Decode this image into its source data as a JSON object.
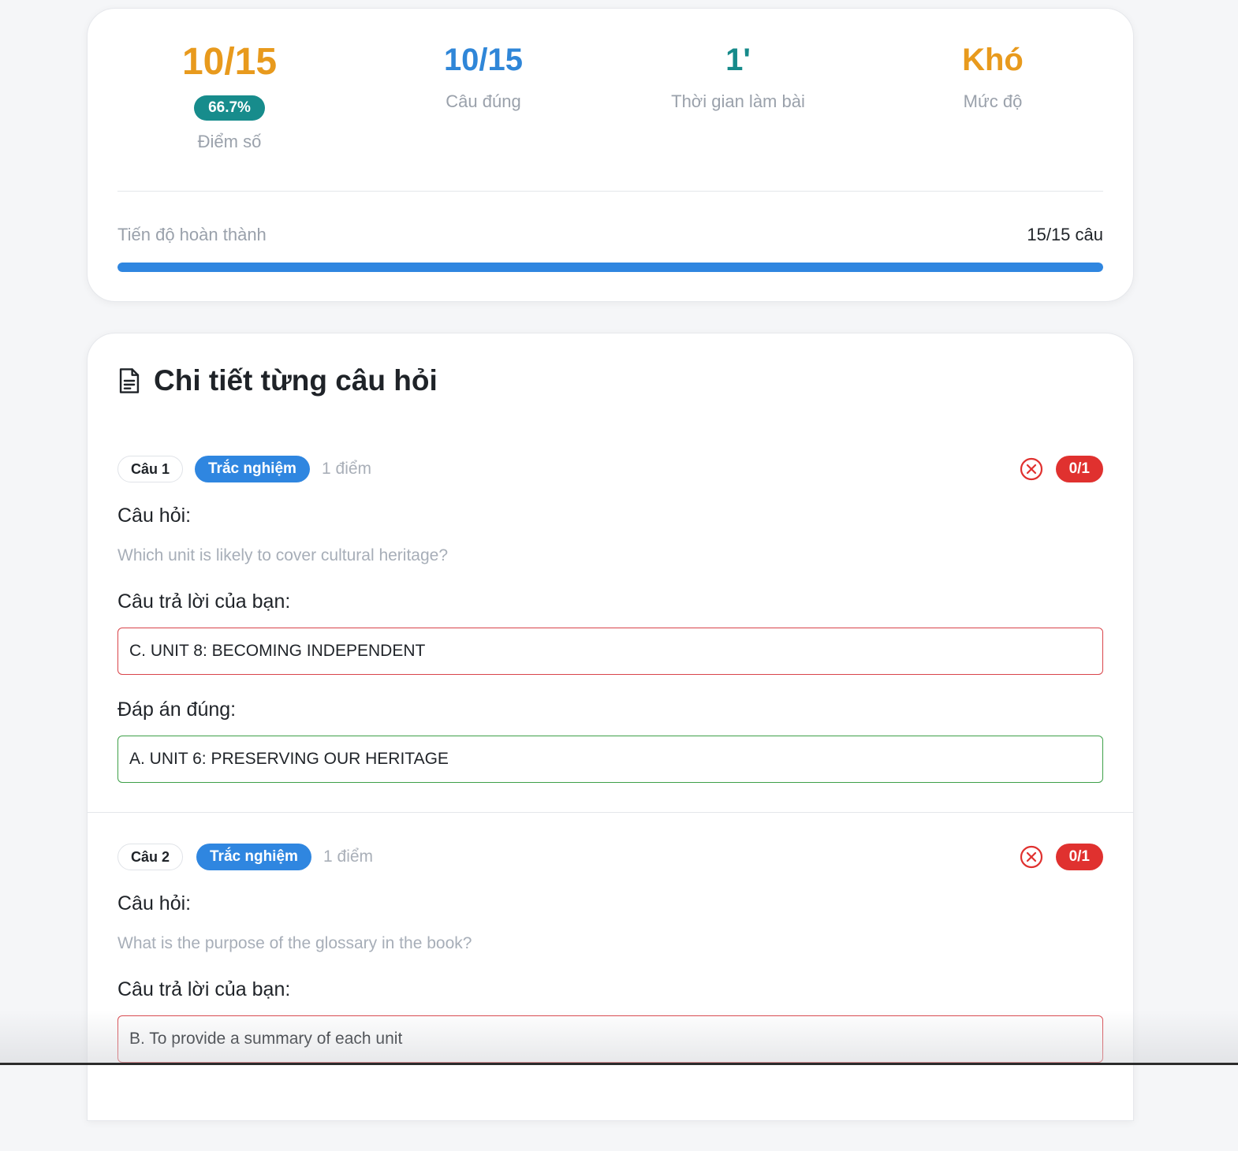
{
  "summary": {
    "score": {
      "value": "10/15",
      "percent": "66.7%",
      "label": "Điểm số"
    },
    "correct": {
      "value": "10/15",
      "label": "Câu đúng"
    },
    "time": {
      "value": "1'",
      "label": "Thời gian làm bài"
    },
    "level": {
      "value": "Khó",
      "label": "Mức độ"
    },
    "progress": {
      "label": "Tiến độ hoàn thành",
      "count": "15/15 câu",
      "fraction": 1.0
    }
  },
  "colors": {
    "score": "#e89a1d",
    "correct": "#2f86d8",
    "time": "#168a8a",
    "level": "#e89a1d",
    "badge": "#178c8c",
    "progress": "#2f86e0",
    "wrong": "#e0312f",
    "right": "#3ea048"
  },
  "details": {
    "title": "Chi tiết từng câu hỏi",
    "title_icon": "document-icon",
    "questions": [
      {
        "number": "Câu 1",
        "type": "Trắc nghiệm",
        "points": "1 điểm",
        "status_icon": "x-circle-icon",
        "score": "0/1",
        "question_label": "Câu hỏi:",
        "question": "Which unit is likely to cover cultural heritage?",
        "your_answer_label": "Câu trả lời của bạn:",
        "your_answer": "C. UNIT 8: BECOMING INDEPENDENT",
        "correct_label": "Đáp án đúng:",
        "correct_answer": "A. UNIT 6: PRESERVING OUR HERITAGE"
      },
      {
        "number": "Câu 2",
        "type": "Trắc nghiệm",
        "points": "1 điểm",
        "status_icon": "x-circle-icon",
        "score": "0/1",
        "question_label": "Câu hỏi:",
        "question": "What is the purpose of the glossary in the book?",
        "your_answer_label": "Câu trả lời của bạn:",
        "your_answer": "B. To provide a summary of each unit"
      }
    ]
  }
}
